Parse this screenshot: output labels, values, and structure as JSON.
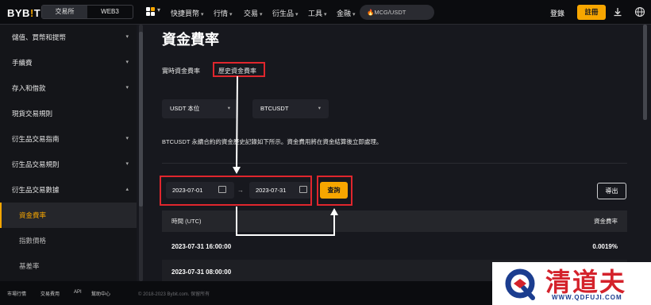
{
  "brand": {
    "logo": "BYB!T",
    "accent": "#f7a600"
  },
  "topnav": {
    "segments": [
      "交易所",
      "WEB3"
    ],
    "items": [
      "快捷買幣",
      "行情",
      "交易",
      "衍生品",
      "工具",
      "金融"
    ],
    "search_text": "🔥MCG/USDT",
    "login": "登錄",
    "register": "註冊"
  },
  "sidebar": {
    "items": [
      "儲值、買幣和提幣",
      "手續費",
      "存入和借款",
      "現貨交易規則",
      "衍生品交易指南",
      "衍生品交易規則",
      "衍生品交易數據"
    ],
    "subitems": [
      "資金費率",
      "指數價格",
      "基差率"
    ]
  },
  "main": {
    "title": "資金費率",
    "tabs": [
      "實時資金費率",
      "歷史資金費率"
    ],
    "dropdowns": [
      "USDT 本位",
      "BTCUSDT"
    ],
    "description": "BTCUSDT 永續合約的資金歷史記錄如下所示。資金費用將在資金結算後立即處理。",
    "date_from": "2023-07-01",
    "date_to": "2023-07-31",
    "date_sep": "→",
    "query_btn": "查詢",
    "export_btn": "導出",
    "table": {
      "headers": [
        "時間 (UTC)",
        "資金費率"
      ],
      "rows": [
        [
          "2023-07-31 16:00:00",
          "0.0019%"
        ],
        [
          "2023-07-31 08:00:00",
          ""
        ]
      ]
    }
  },
  "footer": {
    "links": [
      "市場行情",
      "交易費用",
      "API",
      "幫助中心"
    ],
    "copyright": "© 2018-2023 Bybit.com. 保留所有"
  },
  "watermark": {
    "text": "清道夫",
    "url": "WWW.QDFUJI.COM"
  }
}
